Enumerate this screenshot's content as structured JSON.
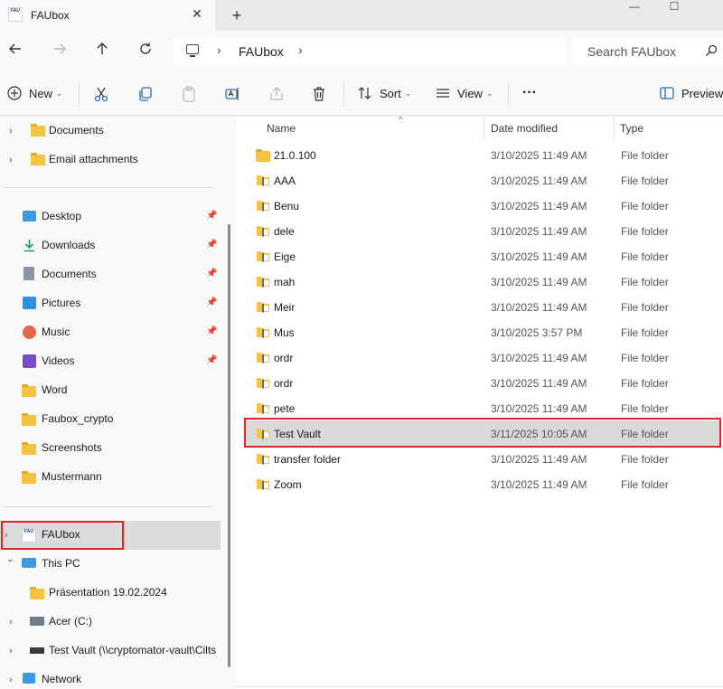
{
  "window": {
    "tab_title": "FAUbox",
    "tab_logo_text": "FAU",
    "new_tab_symbol": "+",
    "close_symbol": "✕",
    "minimize_symbol": "—",
    "maximize_symbol": "☐"
  },
  "address": {
    "path": "FAUbox",
    "search_placeholder": "Search FAUbox"
  },
  "toolbar": {
    "new_label": "New",
    "sort_label": "Sort",
    "view_label": "View",
    "more_label": "···",
    "preview_label": "Preview"
  },
  "navigation": {
    "top_items": [
      "Documents",
      "Email attachments"
    ],
    "quick_access": [
      {
        "label": "Desktop",
        "icon": "desktop-icon",
        "pinned": true
      },
      {
        "label": "Downloads",
        "icon": "download-icon",
        "pinned": true
      },
      {
        "label": "Documents",
        "icon": "document-icon",
        "pinned": true
      },
      {
        "label": "Pictures",
        "icon": "pictures-icon",
        "pinned": true
      },
      {
        "label": "Music",
        "icon": "music-icon",
        "pinned": true
      },
      {
        "label": "Videos",
        "icon": "videos-icon",
        "pinned": true
      },
      {
        "label": "Word",
        "icon": "folder-icon",
        "pinned": false
      },
      {
        "label": "Faubox_crypto",
        "icon": "folder-icon",
        "pinned": false
      },
      {
        "label": "Screenshots",
        "icon": "folder-icon",
        "pinned": false
      },
      {
        "label": "Mustermann",
        "icon": "folder-icon",
        "pinned": false
      }
    ],
    "faubox": "FAUbox",
    "this_pc": "This PC",
    "presentation": "Präsentation 19.02.2024",
    "drive_c": "Acer (C:)",
    "test_vault": "Test Vault (\\\\cryptomator-vault\\Cilts",
    "network": "Network"
  },
  "columns": {
    "name": "Name",
    "date": "Date modified",
    "type": "Type"
  },
  "files": [
    {
      "name": "21.0.100",
      "date": "3/10/2025 11:49 AM",
      "type": "File folder",
      "icon": "folder-icon",
      "selected": false
    },
    {
      "name": "AAA",
      "date": "3/10/2025 11:49 AM",
      "type": "File folder",
      "icon": "sync-folder-icon",
      "selected": false
    },
    {
      "name": "Benu",
      "date": "3/10/2025 11:49 AM",
      "type": "File folder",
      "icon": "sync-folder-icon",
      "selected": false
    },
    {
      "name": "dele",
      "date": "3/10/2025 11:49 AM",
      "type": "File folder",
      "icon": "sync-folder-icon",
      "selected": false
    },
    {
      "name": "Eige",
      "date": "3/10/2025 11:49 AM",
      "type": "File folder",
      "icon": "sync-folder-icon",
      "selected": false
    },
    {
      "name": "mah",
      "date": "3/10/2025 11:49 AM",
      "type": "File folder",
      "icon": "sync-folder-icon",
      "selected": false
    },
    {
      "name": "Meir",
      "date": "3/10/2025 11:49 AM",
      "type": "File folder",
      "icon": "sync-folder-icon",
      "selected": false
    },
    {
      "name": "Mus",
      "date": "3/10/2025 3:57 PM",
      "type": "File folder",
      "icon": "sync-folder-icon",
      "selected": false
    },
    {
      "name": "ordr",
      "date": "3/10/2025 11:49 AM",
      "type": "File folder",
      "icon": "sync-folder-icon",
      "selected": false
    },
    {
      "name": "ordr",
      "date": "3/10/2025 11:49 AM",
      "type": "File folder",
      "icon": "sync-folder-icon",
      "selected": false
    },
    {
      "name": "pete",
      "date": "3/10/2025 11:49 AM",
      "type": "File folder",
      "icon": "sync-folder-icon",
      "selected": false
    },
    {
      "name": "Test Vault",
      "date": "3/11/2025 10:05 AM",
      "type": "File folder",
      "icon": "sync-folder-icon",
      "selected": true
    },
    {
      "name": "transfer folder",
      "date": "3/10/2025 11:49 AM",
      "type": "File folder",
      "icon": "sync-folder-icon",
      "selected": false
    },
    {
      "name": "Zoom",
      "date": "3/10/2025 11:49 AM",
      "type": "File folder",
      "icon": "sync-folder-icon",
      "selected": false
    }
  ],
  "colors": {
    "highlight_red": "#e0262b",
    "folder_yellow": "#f4c542",
    "selection_gray": "#d9d9d9"
  }
}
